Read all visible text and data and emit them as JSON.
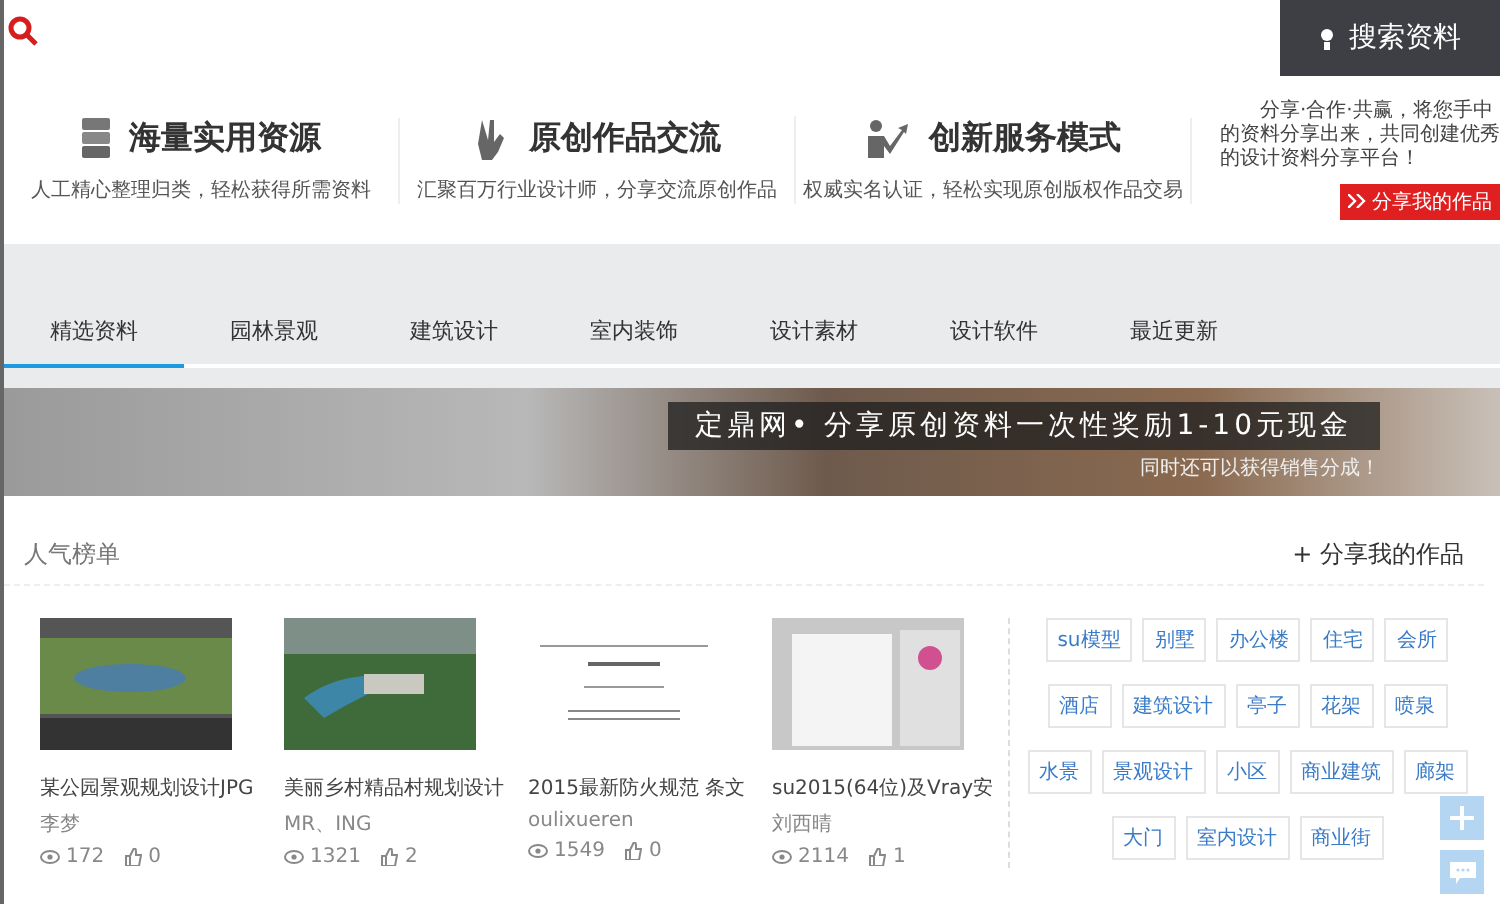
{
  "header": {
    "search_button": "搜索资料"
  },
  "features": [
    {
      "kind": "storage",
      "title": "海量实用资源",
      "subtitle": "人工精心整理归类，轻松获得所需资料"
    },
    {
      "kind": "hand",
      "title": "原创作品交流",
      "subtitle": "汇聚百万行业设计师，分享交流原创作品"
    },
    {
      "kind": "person",
      "title": "创新服务模式",
      "subtitle": "权威实名认证，轻松实现原创版权作品交易"
    }
  ],
  "share_promo": {
    "text": "分享·合作·共赢，将您手中的资料分享出来，共同创建优秀的设计资料分享平台！",
    "button": "分享我的作品"
  },
  "tabs": [
    {
      "label": "精选资料",
      "selected": true
    },
    {
      "label": "园林景观",
      "selected": false
    },
    {
      "label": "建筑设计",
      "selected": false
    },
    {
      "label": "室内装饰",
      "selected": false
    },
    {
      "label": "设计素材",
      "selected": false
    },
    {
      "label": "设计软件",
      "selected": false
    },
    {
      "label": "最近更新",
      "selected": false
    }
  ],
  "banner": {
    "title": "定鼎网• 分享原创资料一次性奖励1-10元现金",
    "subtitle": "同时还可以获得销售分成！"
  },
  "popular": {
    "title": "人气榜单",
    "share_link": "+ 分享我的作品",
    "items": [
      {
        "kind": "park-plan",
        "title": "某公园景观规划设计JPG",
        "author": "李梦",
        "views": "172",
        "likes": "0"
      },
      {
        "kind": "aerial",
        "title": "美丽乡村精品村规划设计",
        "author": "MR、ING",
        "views": "1321",
        "likes": "2"
      },
      {
        "kind": "document",
        "title": "2015最新防火规范 条文",
        "author": "oulixueren",
        "views": "1549",
        "likes": "0"
      },
      {
        "kind": "software",
        "title": "su2015(64位)及Vray安",
        "author": "刘西晴",
        "views": "2114",
        "likes": "1"
      }
    ]
  },
  "tags": [
    "su模型",
    "别墅",
    "办公楼",
    "住宅",
    "会所",
    "酒店",
    "建筑设计",
    "亭子",
    "花架",
    "喷泉",
    "水景",
    "景观设计",
    "小区",
    "商业建筑",
    "廊架",
    "大门",
    "室内设计",
    "商业街"
  ]
}
